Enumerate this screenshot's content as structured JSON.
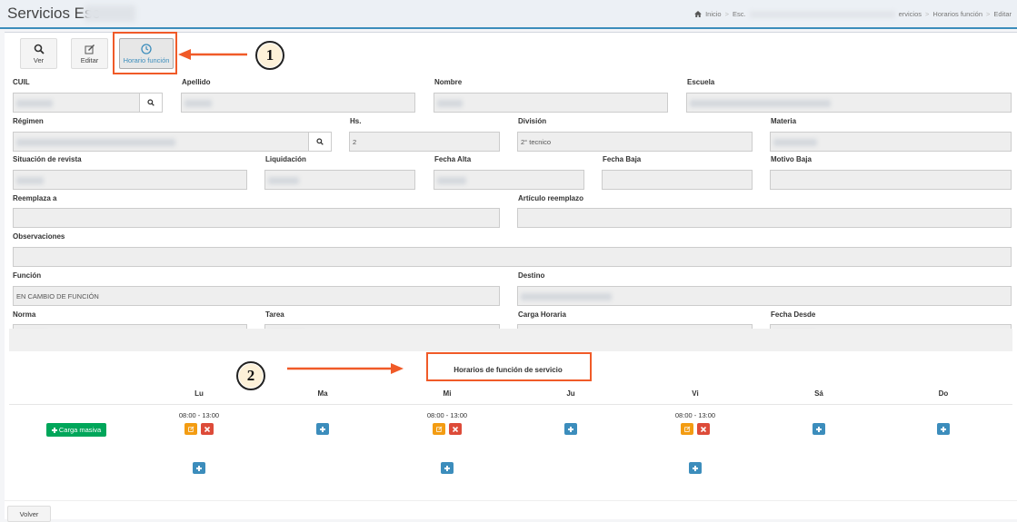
{
  "header": {
    "title": "Servicios Esc",
    "breadcrumb": {
      "home": "Inicio",
      "item1": "Esc.",
      "item2": "ervicios",
      "item3": "Horarios función",
      "item4": "Editar"
    }
  },
  "toolbar": {
    "ver_label": "Ver",
    "editar_label": "Editar",
    "horario_label": "Horario función"
  },
  "annotations": {
    "one": "1",
    "two": "2",
    "color": "#f05a28"
  },
  "form": {
    "cuil_label": "CUIL",
    "apellido_label": "Apellido",
    "nombre_label": "Nombre",
    "escuela_label": "Escuela",
    "regimen_label": "Régimen",
    "hs_label": "Hs.",
    "hs_value": "2",
    "division_label": "División",
    "division_value": "2° tecnico",
    "materia_label": "Materia",
    "situacion_label": "Situación de revista",
    "liquidacion_label": "Liquidación",
    "fecha_alta_label": "Fecha Alta",
    "fecha_baja_label": "Fecha Baja",
    "motivo_baja_label": "Motivo Baja",
    "reemplaza_label": "Reemplaza a",
    "articulo_label": "Artículo reemplazo",
    "observaciones_label": "Observaciones",
    "funcion_label": "Función",
    "funcion_value": "EN CAMBIO DE FUNCIÓN",
    "destino_label": "Destino",
    "norma_label": "Norma",
    "tarea_label": "Tarea",
    "carga_horaria_label": "Carga Horaria",
    "fecha_desde_label": "Fecha Desde"
  },
  "schedule": {
    "title": "Horarios de función de servicio",
    "days": [
      "Lu",
      "Ma",
      "Mi",
      "Ju",
      "Vi",
      "Sá",
      "Do"
    ],
    "carga_masiva": "Carga masiva",
    "time_lu": "08:00 - 13:00",
    "time_mi": "08:00 - 13:00",
    "time_vi": "08:00 - 13:00"
  },
  "footer": {
    "volver_label": "Volver"
  },
  "colors": {
    "primary": "#3c8dbc",
    "success": "#00a65a",
    "warning": "#f39c12",
    "danger": "#dd4b39"
  }
}
